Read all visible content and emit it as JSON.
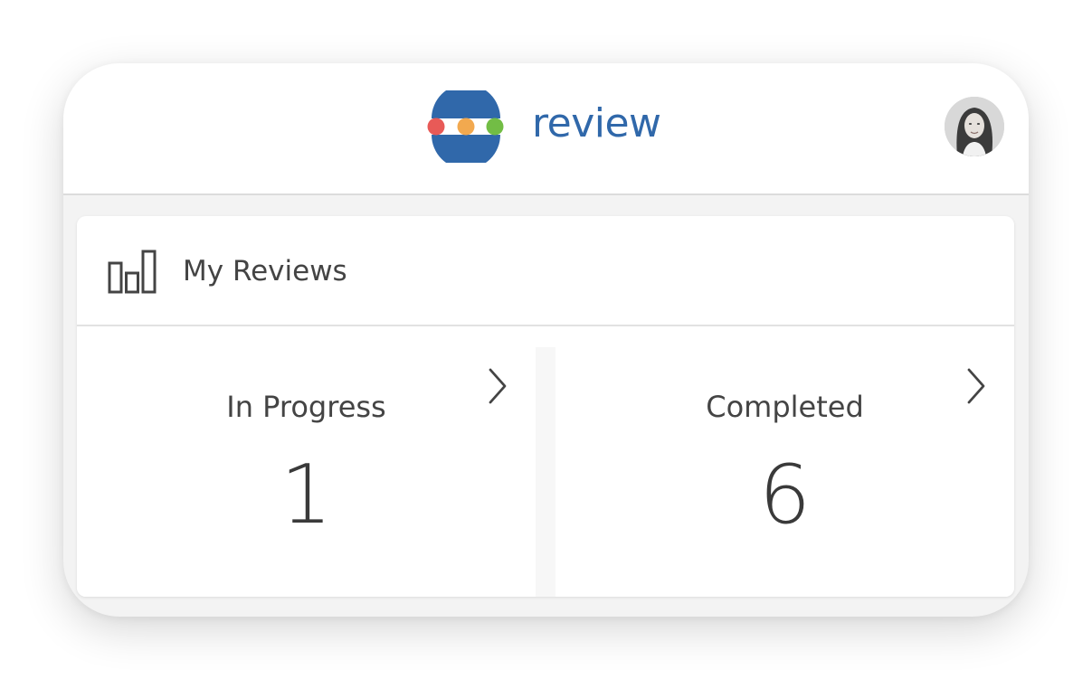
{
  "header": {
    "brand_name": "review",
    "logo_icon": "traffic-dots-logo-icon",
    "avatar_icon": "user-avatar",
    "colors": {
      "brand_blue": "#3068aa",
      "dot_red": "#e85a57",
      "dot_orange": "#f2a94f",
      "dot_green": "#72bd45"
    }
  },
  "reviews_card": {
    "title": "My Reviews",
    "icon": "bar-chart-icon",
    "tiles": [
      {
        "label": "In Progress",
        "count": "1",
        "icon": "chevron-right-icon"
      },
      {
        "label": "Completed",
        "count": "6",
        "icon": "chevron-right-icon"
      }
    ]
  }
}
